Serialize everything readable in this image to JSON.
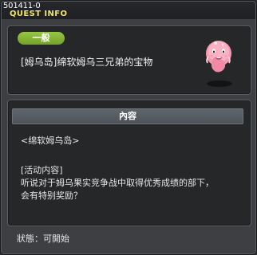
{
  "window": {
    "quest_id": "501411-0",
    "title": "QUEST INFO"
  },
  "quest": {
    "category": "一般",
    "name": "[姆乌岛]绵软姆乌三兄弟的宝物"
  },
  "content": {
    "header": "內容",
    "lines": [
      "<绵软姆乌岛>",
      "[活动内容]",
      "听说对于姆乌果实竞争战中取得优秀成绩的部下，",
      "会有特别奖励？"
    ]
  },
  "status": {
    "text": "狀態：可開始"
  },
  "colors": {
    "title": "#f1e36a",
    "badge": "#86b537",
    "mascot": "#f9a2b5"
  },
  "icons": {
    "mascot": "pink-mushroom-mascot-icon"
  }
}
